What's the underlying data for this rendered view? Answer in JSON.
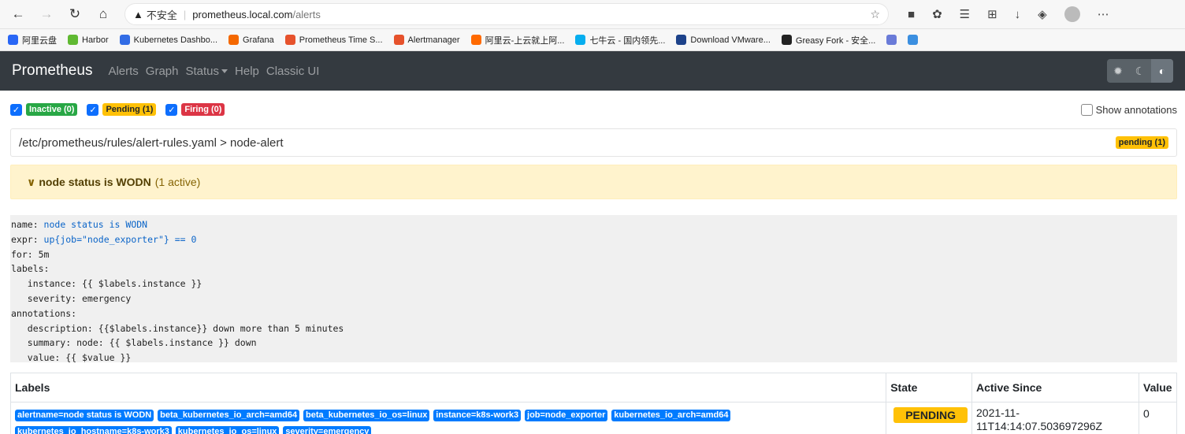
{
  "browser": {
    "url_warning": "不安全",
    "url_host": "prometheus.local.com",
    "url_path": "/alerts",
    "bookmarks": [
      {
        "label": "阿里云盘",
        "color": "#2966f5"
      },
      {
        "label": "Harbor",
        "color": "#60b932"
      },
      {
        "label": "Kubernetes Dashbo...",
        "color": "#326ce5"
      },
      {
        "label": "Grafana",
        "color": "#f46800"
      },
      {
        "label": "Prometheus Time S...",
        "color": "#e6522c"
      },
      {
        "label": "Alertmanager",
        "color": "#e6522c"
      },
      {
        "label": "阿里云-上云就上阿...",
        "color": "#ff6a00"
      },
      {
        "label": "七牛云 - 国内领先...",
        "color": "#06aeef"
      },
      {
        "label": "Download VMware...",
        "color": "#1d428a"
      },
      {
        "label": "Greasy Fork - 安全...",
        "color": "#222222"
      }
    ]
  },
  "navbar": {
    "brand": "Prometheus",
    "links": [
      "Alerts",
      "Graph",
      "Status",
      "Help",
      "Classic UI"
    ]
  },
  "filters": {
    "inactive": "Inactive (0)",
    "pending": "Pending (1)",
    "firing": "Firing (0)",
    "show_annotations": "Show annotations"
  },
  "group": {
    "path": "/etc/prometheus/rules/alert-rules.yaml > node-alert",
    "badge": "pending (1)"
  },
  "rule": {
    "name": "node status is WODN",
    "count": "(1 active)",
    "definition": {
      "name_key": "name: ",
      "name_val": "node status is WODN",
      "expr_key": "expr: ",
      "expr_val": "up{job=\"node_exporter\"} == 0",
      "for_line": "for: 5m",
      "labels_key": "labels:",
      "label_instance": "   instance: {{ $labels.instance }}",
      "label_severity": "   severity: emergency",
      "annotations_key": "annotations:",
      "ann_description": "   description: {{$labels.instance}} down more than 5 minutes",
      "ann_summary": "   summary: node: {{ $labels.instance }} down",
      "ann_value": "   value: {{ $value }}"
    }
  },
  "table": {
    "headers": [
      "Labels",
      "State",
      "Active Since",
      "Value"
    ],
    "row": {
      "labels": [
        "alertname=node status is WODN",
        "beta_kubernetes_io_arch=amd64",
        "beta_kubernetes_io_os=linux",
        "instance=k8s-work3",
        "job=node_exporter",
        "kubernetes_io_arch=amd64",
        "kubernetes_io_hostname=k8s-work3",
        "kubernetes_io_os=linux",
        "severity=emergency"
      ],
      "state": "PENDING",
      "active_since_1": "2021-11-",
      "active_since_2": "11T14:14:07.503697296Z",
      "value": "0"
    }
  }
}
